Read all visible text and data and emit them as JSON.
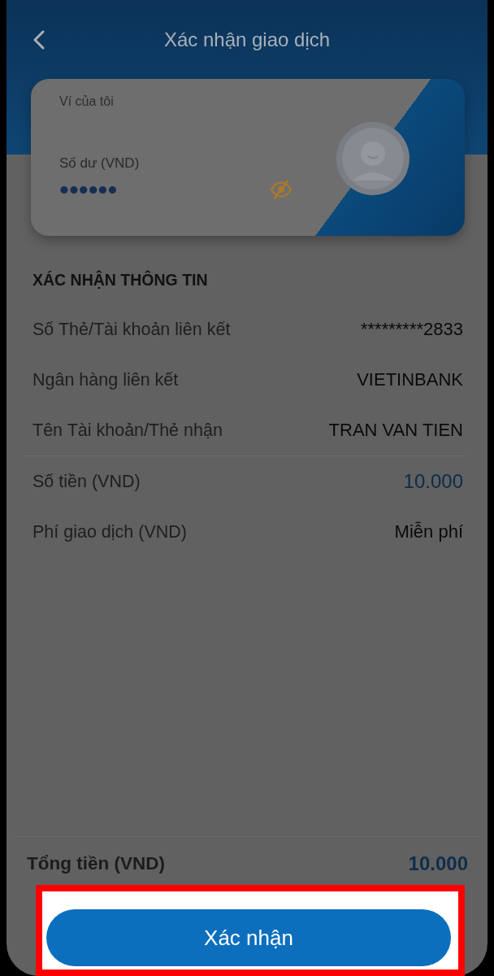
{
  "header": {
    "title": "Xác nhận giao dịch"
  },
  "wallet_card": {
    "title": "Ví của tôi",
    "balance_label": "Số dư (VND)",
    "balance": "••••••",
    "balance_visible": false
  },
  "confirmation": {
    "title": "XÁC NHẬN THÔNG TIN",
    "groups": [
      {
        "rows": [
          {
            "label": "Số Thẻ/Tài khoản liên kết",
            "value": "*********2833",
            "kind": "text"
          },
          {
            "label": "Ngân hàng liên kết",
            "value": "VIETINBANK",
            "kind": "text"
          },
          {
            "label": "Tên Tài khoản/Thẻ nhận",
            "value": "TRAN VAN TIEN",
            "kind": "text"
          }
        ]
      },
      {
        "rows": [
          {
            "label": "Số tiền (VND)",
            "value": "10.000",
            "kind": "amount"
          },
          {
            "label": "Phí giao dịch (VND)",
            "value": "Miễn phí",
            "kind": "text"
          }
        ]
      }
    ]
  },
  "total": {
    "label": "Tổng tiền (VND)",
    "value": "10.000"
  },
  "confirm_button": {
    "label": "Xác nhận",
    "highlighted": true
  }
}
